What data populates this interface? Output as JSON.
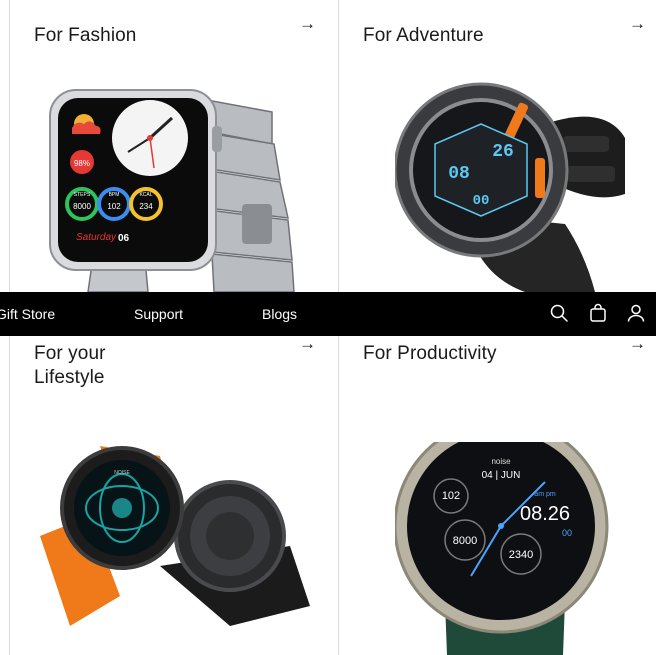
{
  "cards": [
    {
      "title": "For Fashion",
      "arrow": "→"
    },
    {
      "title": "For Adventure",
      "arrow": "→"
    },
    {
      "title": "For your\nLifestyle",
      "arrow": "→"
    },
    {
      "title": "For Productivity",
      "arrow": "→"
    }
  ],
  "nav": {
    "links": [
      "Gift Store",
      "Support",
      "Blogs"
    ],
    "icons": [
      "search-icon",
      "shopping-bag-icon",
      "user-icon"
    ]
  },
  "watch_faces": {
    "fashion": {
      "heart": "98%",
      "steps": "8000",
      "bpm": "102",
      "kcal": "234",
      "steps_label": "STEPS",
      "bpm_label": "BPM",
      "kcal_label": "KCAL",
      "day": "Saturday",
      "date": "06"
    },
    "adventure": {
      "left": "08",
      "right": "26",
      "bottom": "00"
    },
    "lifestyle": {
      "brand": "NOISE"
    },
    "productivity": {
      "brand": "noise",
      "date": "04 | JUN",
      "bpm": "102",
      "ampm": "am pm",
      "time": "08.26",
      "seconds": "00",
      "steps": "8000",
      "kcal": "2340"
    }
  },
  "colors": {
    "navbar": "#000000",
    "accent_orange": "#f07a1a",
    "strap_green": "#1f4a3a"
  }
}
